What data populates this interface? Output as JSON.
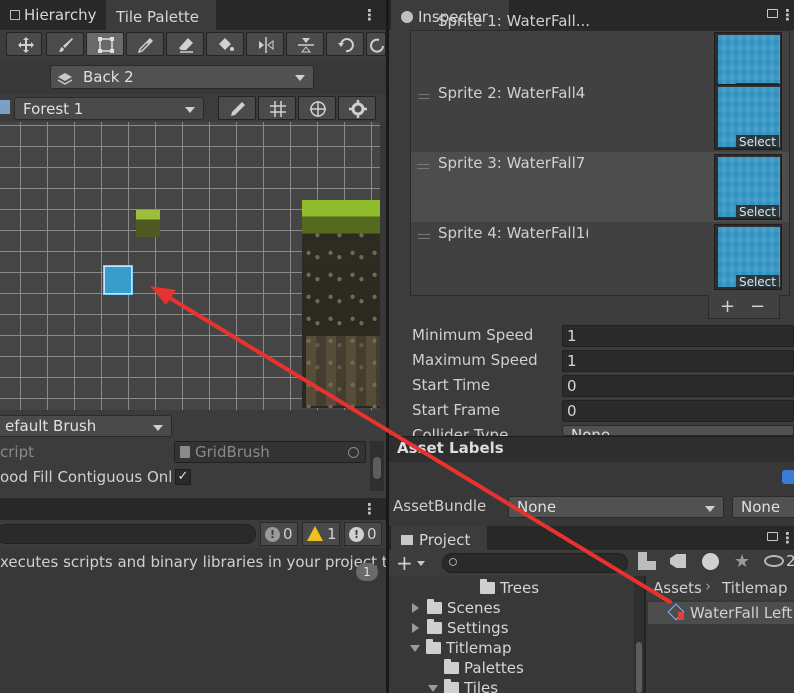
{
  "left": {
    "tabs": [
      "Hierarchy",
      "Tile Palette"
    ],
    "layer_dropdown": "Back 2",
    "palette_dropdown": "Forest 1",
    "brush_dropdown": "efault Brush",
    "script_label": "cript",
    "script_value": "GridBrush",
    "flood_fill_label": "ood Fill Contiguous Onl",
    "console": {
      "counts": [
        "0",
        "1",
        "0"
      ],
      "message": "xecutes scripts and binary libraries in your project th",
      "badge": "1"
    }
  },
  "inspector": {
    "tab": "Inspector",
    "sprites": [
      {
        "label": "Sprite 1: WaterFall..."
      },
      {
        "label": "Sprite 2: WaterFall4"
      },
      {
        "label": "Sprite 3: WaterFall7"
      },
      {
        "label": "Sprite 4: WaterFall1("
      }
    ],
    "select_label": "Select",
    "plus": "+",
    "minus": "−",
    "fields": [
      {
        "label": "Minimum Speed",
        "value": "1"
      },
      {
        "label": "Maximum Speed",
        "value": "1"
      },
      {
        "label": "Start Time",
        "value": "0"
      },
      {
        "label": "Start Frame",
        "value": "0"
      },
      {
        "label": "Collider Type",
        "value": "None"
      }
    ],
    "asset_labels": "Asset Labels",
    "asset_bundle_label": "AssetBundle",
    "asset_bundle_value": "None",
    "asset_bundle_variant": "None"
  },
  "project": {
    "tab": "Project",
    "breadcrumb": [
      "Assets",
      "Titlemap"
    ],
    "folders": [
      {
        "name": "Trees",
        "expanded": null
      },
      {
        "name": "Scenes",
        "expanded": false
      },
      {
        "name": "Settings",
        "expanded": false
      },
      {
        "name": "Titlemap",
        "expanded": true
      },
      {
        "name": "Palettes",
        "expanded": null
      },
      {
        "name": "Tiles",
        "expanded": true
      }
    ],
    "asset": "WaterFall Left",
    "hidden_count": "2"
  },
  "colors": {
    "annotation_arrow": "#e8322f",
    "water_tile": "#3a9ccb",
    "selection_highlight": "#4d4d4d"
  }
}
